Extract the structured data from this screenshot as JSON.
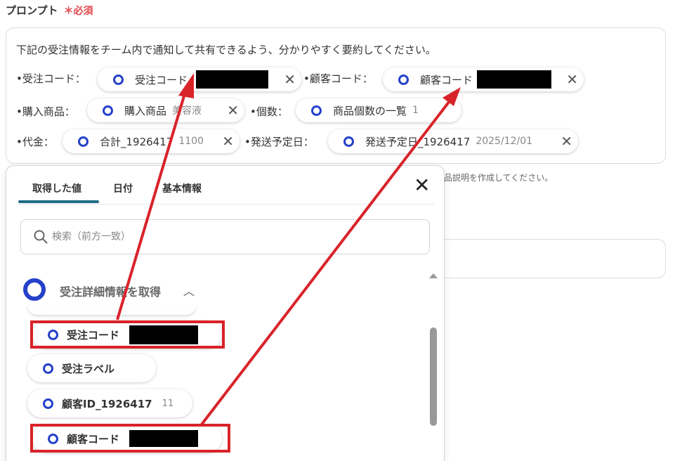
{
  "field": {
    "label": "プロンプト",
    "required": "＊必須"
  },
  "prompt": {
    "text": "下記の受注情報をチーム内で通知して共有できるよう、分かりやすく要約してください。",
    "lines": [
      {
        "label": "•受注コード：",
        "chip": {
          "name": "受注コード",
          "value": ""
        }
      },
      {
        "label": "•顧客コード：",
        "chip": {
          "name": "顧客コード",
          "value": ""
        }
      },
      {
        "label": "•購入商品：",
        "chip": {
          "name": "購入商品",
          "value": "美容液"
        }
      },
      {
        "label": "•個数：",
        "chip": {
          "name": "商品個数の一覧",
          "value": "1"
        }
      },
      {
        "label": "•代金：",
        "chip": {
          "name": "合計_1926417",
          "value": "1100"
        }
      },
      {
        "label": "•発送予定日：",
        "chip": {
          "name": "発送予定日_1926417",
          "value": "2025/12/01"
        }
      }
    ]
  },
  "hint": "品説明を作成してください。",
  "picker": {
    "tabs": [
      "取得した値",
      "日付",
      "基本情報"
    ],
    "search_placeholder": "検索（前方一致）",
    "group": {
      "title": "受注詳細情報を取得"
    },
    "items": [
      {
        "name": "受注コード",
        "value": ""
      },
      {
        "name": "受注ラベル",
        "value": ""
      },
      {
        "name": "顧客ID_1926417",
        "value": "11"
      },
      {
        "name": "顧客コード",
        "value": ""
      }
    ]
  },
  "colors": {
    "accent": "#2541c9",
    "highlight": "#d9232a",
    "tab_underline": "#1f6e86",
    "required": "#e5484d"
  },
  "icons": {
    "close": "close-icon",
    "search": "search-icon",
    "caret": "chevron-up-icon",
    "variable": "variable-ring-icon"
  }
}
